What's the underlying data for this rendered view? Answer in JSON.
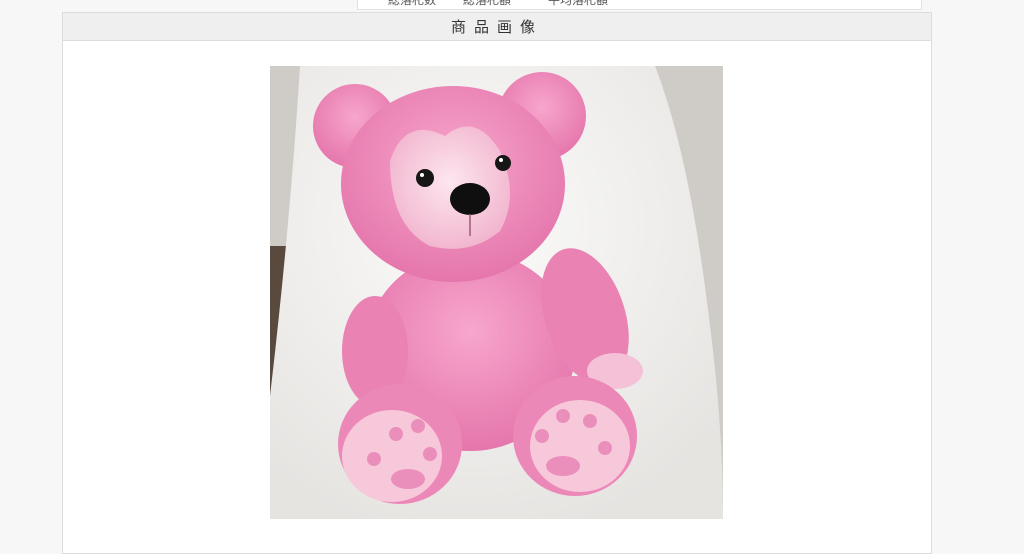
{
  "top_strip": {
    "items": [
      "総落札数",
      "総落札額",
      "平均落札額"
    ]
  },
  "panel": {
    "title": "商品画像"
  },
  "image": {
    "subject": "pink-teddy-bear-photo"
  }
}
